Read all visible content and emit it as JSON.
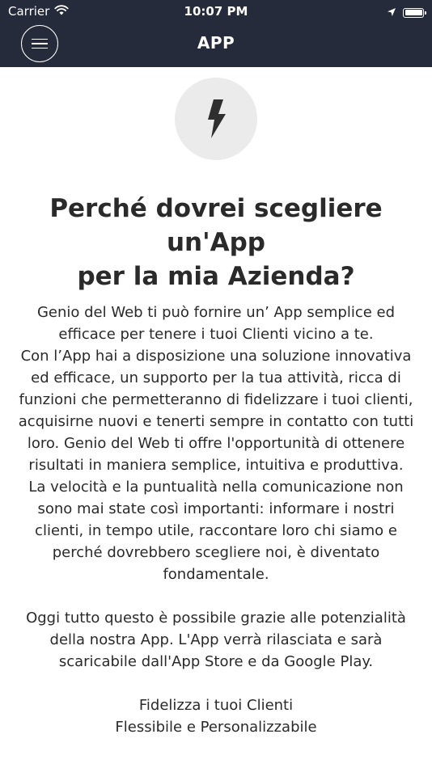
{
  "status_bar": {
    "carrier": "Carrier",
    "time": "10:07 PM"
  },
  "nav": {
    "title": "APP",
    "menu_icon": "hamburger-menu-icon"
  },
  "hero": {
    "icon": "lightning-bolt-icon",
    "heading_line1": "Perché dovrei scegliere un'App",
    "heading_line2": "per la mia Azienda?"
  },
  "body": {
    "p1": "Genio del Web ti può fornire un’ App semplice ed efficace per tenere i tuoi Clienti vicino a te.",
    "p2": "Con l’App hai a disposizione una soluzione innovativa ed efficace, un supporto per la tua attività, ricca di funzioni che permetteranno di fidelizzare i tuoi clienti, acquisirne nuovi e tenerti sempre in contatto con tutti loro. Genio del Web ti offre l'opportunità di ottenere risultati in maniera semplice, intuitiva e produttiva.",
    "p3": "La velocità e la puntualità nella comunicazione non sono mai state così importanti: informare i nostri clienti, in tempo utile, raccontare loro chi siamo e perché dovrebbero scegliere noi, è diventato fondamentale.",
    "p4": "Oggi tutto questo è possibile grazie alle potenzialità della nostra App. L'App verrà rilasciata e sarà scaricabile dall'App Store e da Google Play.",
    "features": [
      "Fidelizza i tuoi Clienti",
      "Flessibile e Personalizzabile"
    ]
  }
}
